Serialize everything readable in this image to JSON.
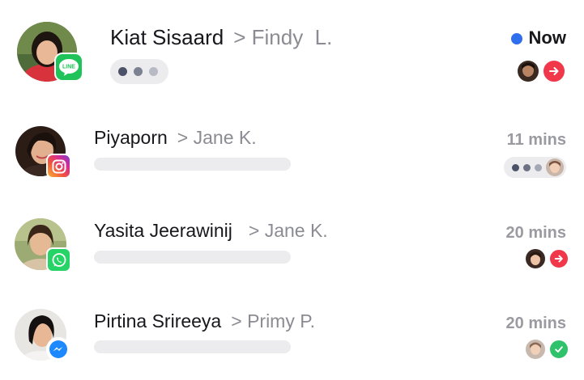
{
  "colors": {
    "unread_dot": "#2f6fed",
    "line_green": "#1fc35a",
    "whatsapp_green": "#25d366",
    "messenger_blue": "#1e88ff",
    "forward_red": "#f0384a",
    "check_green": "#2fc26b",
    "preview_bar": "#ececef"
  },
  "conversations": [
    {
      "contact_name": "Kiat Sisaard",
      "separator": ">",
      "assignee": "Findy  L.",
      "channel_icon": "line-icon",
      "channel_label": "LINE",
      "time": "Now",
      "unread": true,
      "status_icon": "forward-arrow-icon"
    },
    {
      "contact_name": "Piyaporn",
      "separator": ">",
      "assignee": "Jane K.",
      "channel_icon": "instagram-icon",
      "time": "11 mins",
      "status_icon": "typing-indicator"
    },
    {
      "contact_name": "Yasita Jeerawinij",
      "separator": ">",
      "assignee": "Jane K.",
      "channel_icon": "whatsapp-icon",
      "time": "20 mins",
      "status_icon": "forward-arrow-icon"
    },
    {
      "contact_name": "Pirtina Srireeya",
      "separator": ">",
      "assignee": "Primy P.",
      "channel_icon": "messenger-icon",
      "time": "20 mins",
      "status_icon": "check-icon"
    }
  ]
}
